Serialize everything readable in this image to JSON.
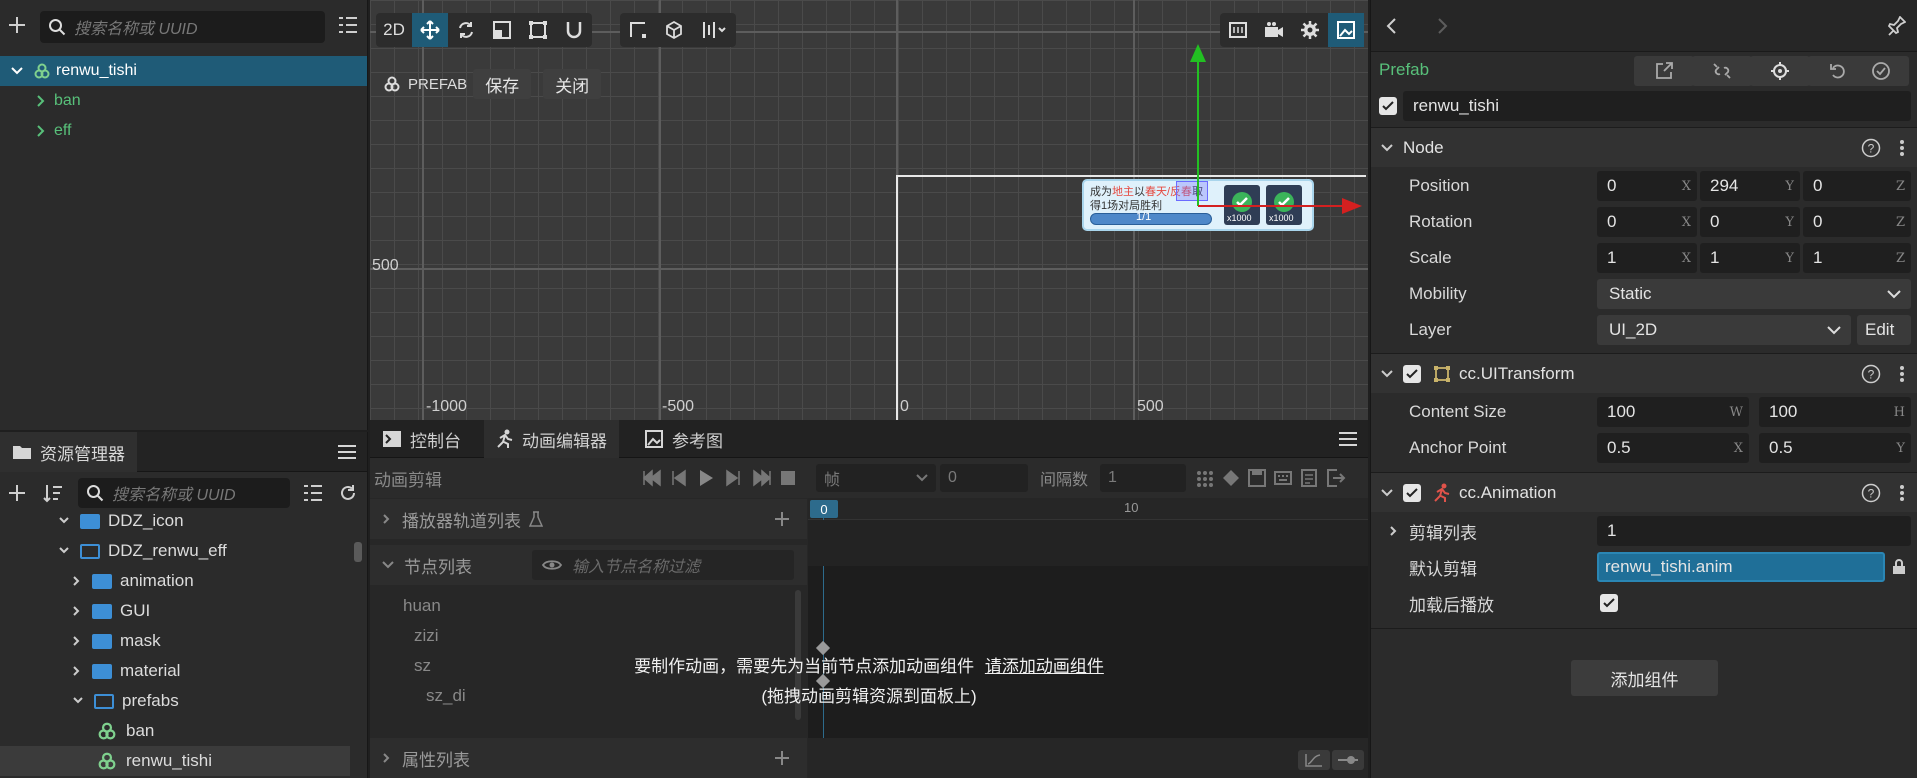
{
  "hierarchy": {
    "search_placeholder": "搜索名称或 UUID",
    "root": "renwu_tishi",
    "children": [
      "ban",
      "eff"
    ]
  },
  "assets": {
    "tab_label": "资源管理器",
    "search_placeholder": "搜索名称或 UUID",
    "items": [
      {
        "label": "DDZ_icon"
      },
      {
        "label": "DDZ_renwu_eff"
      },
      {
        "label": "animation"
      },
      {
        "label": "GUI"
      },
      {
        "label": "mask"
      },
      {
        "label": "material"
      },
      {
        "label": "prefabs"
      },
      {
        "label": "ban"
      },
      {
        "label": "renwu_tishi"
      }
    ]
  },
  "scene": {
    "mode_2d": "2D",
    "prefab_label": "PREFAB",
    "save_label": "保存",
    "close_label": "关闭",
    "tick_y": "500",
    "ticks_x": [
      "-1000",
      "-500",
      "0",
      "500"
    ],
    "preview": {
      "text_line1_a": "成为",
      "text_line1_b": "地主",
      "text_line1_c": "以",
      "text_line1_d": "春天/反春",
      "text_line1_e": "取",
      "text_line2": "得1场对局胜利",
      "progress": "1/1",
      "reward1": "x1000",
      "reward2": "x1000"
    }
  },
  "anim_editor": {
    "tabs": [
      "控制台",
      "动画编辑器",
      "参考图"
    ],
    "clip_label": "动画剪辑",
    "frame_unit": "帧",
    "frame_value": "0",
    "interval_label": "间隔数",
    "interval_value": "1",
    "player_tracks": "播放器轨道列表",
    "node_list": "节点列表",
    "node_filter_placeholder": "输入节点名称过滤",
    "nodes": [
      "huan",
      "zizi",
      "sz",
      "sz_di"
    ],
    "prop_list": "属性列表",
    "timeline_marks": [
      "0",
      "10"
    ],
    "hint_line1_a": "要制作动画，需要先为当前节点添加动画组件",
    "hint_line1_link": "请添加动画组件",
    "hint_line2": "(拖拽动画剪辑资源到面板上)"
  },
  "inspector": {
    "prefab_label": "Prefab",
    "node_name": "renwu_tishi",
    "node_section": "Node",
    "position": {
      "label": "Position",
      "x": "0",
      "y": "294",
      "z": "0"
    },
    "rotation": {
      "label": "Rotation",
      "x": "0",
      "y": "0",
      "z": "0"
    },
    "scale": {
      "label": "Scale",
      "x": "1",
      "y": "1",
      "z": "1"
    },
    "mobility": {
      "label": "Mobility",
      "value": "Static"
    },
    "layer": {
      "label": "Layer",
      "value": "UI_2D",
      "edit": "Edit"
    },
    "ui_transform": {
      "title": "cc.UITransform",
      "content_size_label": "Content Size",
      "w": "100",
      "h": "100",
      "anchor_label": "Anchor Point",
      "ax": "0.5",
      "ay": "0.5"
    },
    "animation": {
      "title": "cc.Animation",
      "clips_label": "剪辑列表",
      "clips_value": "1",
      "default_label": "默认剪辑",
      "default_value": "renwu_tishi.anim",
      "autoplay_label": "加载后播放"
    },
    "add_component": "添加组件",
    "axis": {
      "x": "X",
      "y": "Y",
      "z": "Z",
      "w": "W",
      "h": "H"
    }
  }
}
